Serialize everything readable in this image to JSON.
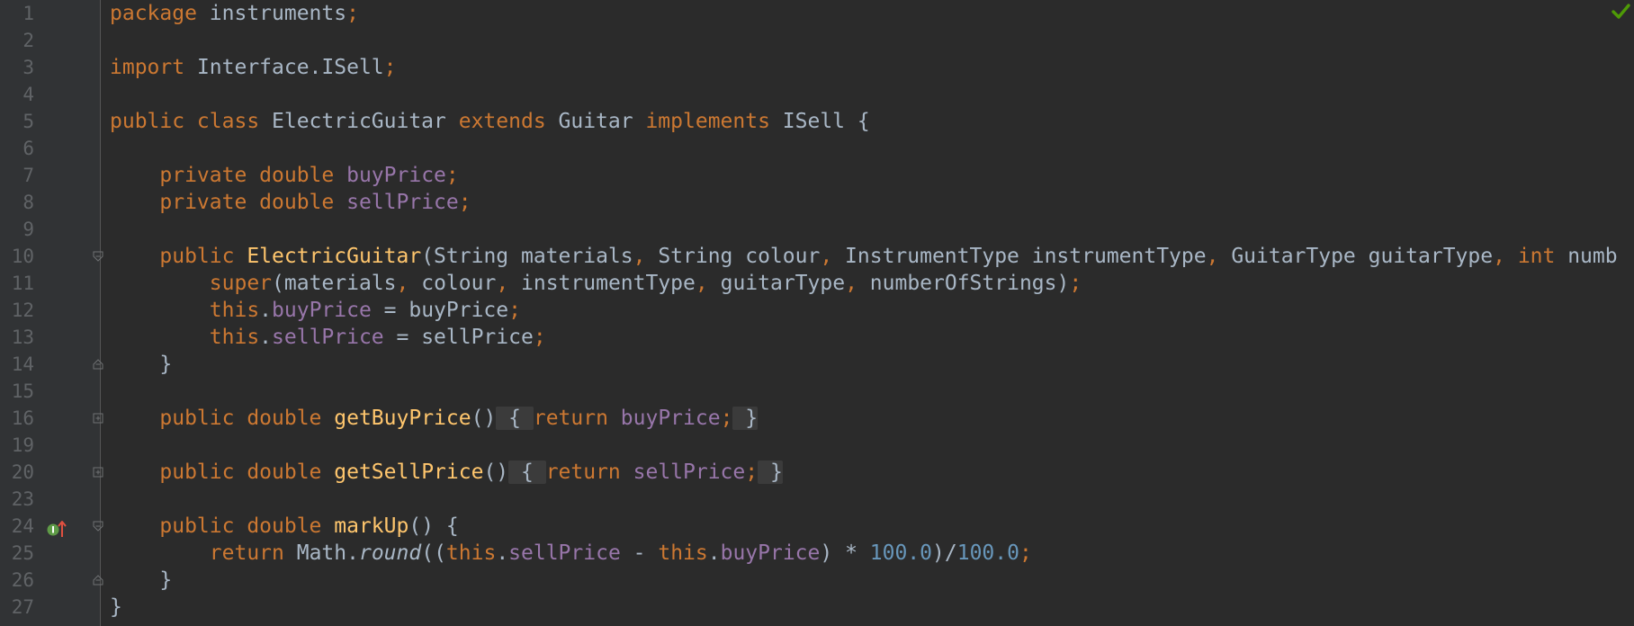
{
  "editor": {
    "colors": {
      "background": "#2b2b2b",
      "gutter": "#313335",
      "keyword": "#cc7832",
      "method_decl": "#ffc66d",
      "field": "#9876aa",
      "number": "#6897bb",
      "text": "#a9b7c6",
      "line_number": "#606366",
      "check": "#4e9a06"
    },
    "icons": {
      "status": "check-icon",
      "override": "implements-method-icon",
      "fold_open": "fold-open-icon",
      "fold_close": "fold-close-icon",
      "fold_expand": "fold-expand-icon"
    },
    "lines": [
      {
        "num": "1",
        "tokens": [
          {
            "t": "package ",
            "c": "kw"
          },
          {
            "t": "instruments"
          },
          {
            "t": ";",
            "c": "kw"
          }
        ]
      },
      {
        "num": "2",
        "tokens": []
      },
      {
        "num": "3",
        "tokens": [
          {
            "t": "import ",
            "c": "kw"
          },
          {
            "t": "Interface.ISell"
          },
          {
            "t": ";",
            "c": "kw"
          }
        ]
      },
      {
        "num": "4",
        "tokens": []
      },
      {
        "num": "5",
        "tokens": [
          {
            "t": "public class ",
            "c": "kw"
          },
          {
            "t": "ElectricGuitar "
          },
          {
            "t": "extends ",
            "c": "kw"
          },
          {
            "t": "Guitar "
          },
          {
            "t": "implements ",
            "c": "kw"
          },
          {
            "t": "ISell {"
          }
        ]
      },
      {
        "num": "6",
        "tokens": []
      },
      {
        "num": "7",
        "tokens": [
          {
            "t": "    "
          },
          {
            "t": "private double ",
            "c": "kw"
          },
          {
            "t": "buyPrice",
            "c": "fld"
          },
          {
            "t": ";",
            "c": "kw"
          }
        ]
      },
      {
        "num": "8",
        "tokens": [
          {
            "t": "    "
          },
          {
            "t": "private double ",
            "c": "kw"
          },
          {
            "t": "sellPrice",
            "c": "fld"
          },
          {
            "t": ";",
            "c": "kw"
          }
        ]
      },
      {
        "num": "9",
        "tokens": []
      },
      {
        "num": "10",
        "fold": "open",
        "tokens": [
          {
            "t": "    "
          },
          {
            "t": "public ",
            "c": "kw"
          },
          {
            "t": "ElectricGuitar",
            "c": "fn"
          },
          {
            "t": "(String materials"
          },
          {
            "t": ", ",
            "c": "kw"
          },
          {
            "t": "String colour"
          },
          {
            "t": ", ",
            "c": "kw"
          },
          {
            "t": "InstrumentType instrumentType"
          },
          {
            "t": ", ",
            "c": "kw"
          },
          {
            "t": "GuitarType guitarType"
          },
          {
            "t": ", ",
            "c": "kw"
          },
          {
            "t": "int ",
            "c": "kw"
          },
          {
            "t": "numb"
          }
        ]
      },
      {
        "num": "11",
        "tokens": [
          {
            "t": "        "
          },
          {
            "t": "super",
            "c": "kw"
          },
          {
            "t": "(materials"
          },
          {
            "t": ", ",
            "c": "kw"
          },
          {
            "t": "colour"
          },
          {
            "t": ", ",
            "c": "kw"
          },
          {
            "t": "instrumentType"
          },
          {
            "t": ", ",
            "c": "kw"
          },
          {
            "t": "guitarType"
          },
          {
            "t": ", ",
            "c": "kw"
          },
          {
            "t": "numberOfStrings)"
          },
          {
            "t": ";",
            "c": "kw"
          }
        ]
      },
      {
        "num": "12",
        "tokens": [
          {
            "t": "        "
          },
          {
            "t": "this",
            "c": "kw"
          },
          {
            "t": "."
          },
          {
            "t": "buyPrice",
            "c": "fld"
          },
          {
            "t": " = buyPrice"
          },
          {
            "t": ";",
            "c": "kw"
          }
        ]
      },
      {
        "num": "13",
        "tokens": [
          {
            "t": "        "
          },
          {
            "t": "this",
            "c": "kw"
          },
          {
            "t": "."
          },
          {
            "t": "sellPrice",
            "c": "fld"
          },
          {
            "t": " = sellPrice"
          },
          {
            "t": ";",
            "c": "kw"
          }
        ]
      },
      {
        "num": "14",
        "fold": "close",
        "tokens": [
          {
            "t": "    }"
          }
        ]
      },
      {
        "num": "15",
        "tokens": []
      },
      {
        "num": "16",
        "fold": "expand",
        "tokens": [
          {
            "t": "    "
          },
          {
            "t": "public double ",
            "c": "kw"
          },
          {
            "t": "getBuyPrice",
            "c": "fn"
          },
          {
            "t": "()"
          },
          {
            "t": " { ",
            "c": "box"
          },
          {
            "t": "return ",
            "c": "kw"
          },
          {
            "t": "buyPrice",
            "c": "fld"
          },
          {
            "t": ";",
            "c": "kw"
          },
          {
            "t": " }",
            "c": "box"
          }
        ]
      },
      {
        "num": "19",
        "tokens": []
      },
      {
        "num": "20",
        "fold": "expand",
        "tokens": [
          {
            "t": "    "
          },
          {
            "t": "public double ",
            "c": "kw"
          },
          {
            "t": "getSellPrice",
            "c": "fn"
          },
          {
            "t": "()"
          },
          {
            "t": " { ",
            "c": "box"
          },
          {
            "t": "return ",
            "c": "kw"
          },
          {
            "t": "sellPrice",
            "c": "fld"
          },
          {
            "t": ";",
            "c": "kw"
          },
          {
            "t": " }",
            "c": "box"
          }
        ]
      },
      {
        "num": "23",
        "tokens": []
      },
      {
        "num": "24",
        "fold": "open",
        "override": true,
        "tokens": [
          {
            "t": "    "
          },
          {
            "t": "public double ",
            "c": "kw"
          },
          {
            "t": "markUp",
            "c": "fn"
          },
          {
            "t": "() {"
          }
        ]
      },
      {
        "num": "25",
        "tokens": [
          {
            "t": "        "
          },
          {
            "t": "return ",
            "c": "kw"
          },
          {
            "t": "Math."
          },
          {
            "t": "round",
            "c": "it"
          },
          {
            "t": "(("
          },
          {
            "t": "this",
            "c": "kw"
          },
          {
            "t": "."
          },
          {
            "t": "sellPrice",
            "c": "fld"
          },
          {
            "t": " - "
          },
          {
            "t": "this",
            "c": "kw"
          },
          {
            "t": "."
          },
          {
            "t": "buyPrice",
            "c": "fld"
          },
          {
            "t": ") * "
          },
          {
            "t": "100.0",
            "c": "num"
          },
          {
            "t": ")/"
          },
          {
            "t": "100.0",
            "c": "num"
          },
          {
            "t": ";",
            "c": "kw"
          }
        ]
      },
      {
        "num": "26",
        "fold": "close",
        "tokens": [
          {
            "t": "    }"
          }
        ]
      },
      {
        "num": "27",
        "tokens": [
          {
            "t": "}"
          }
        ]
      }
    ]
  }
}
